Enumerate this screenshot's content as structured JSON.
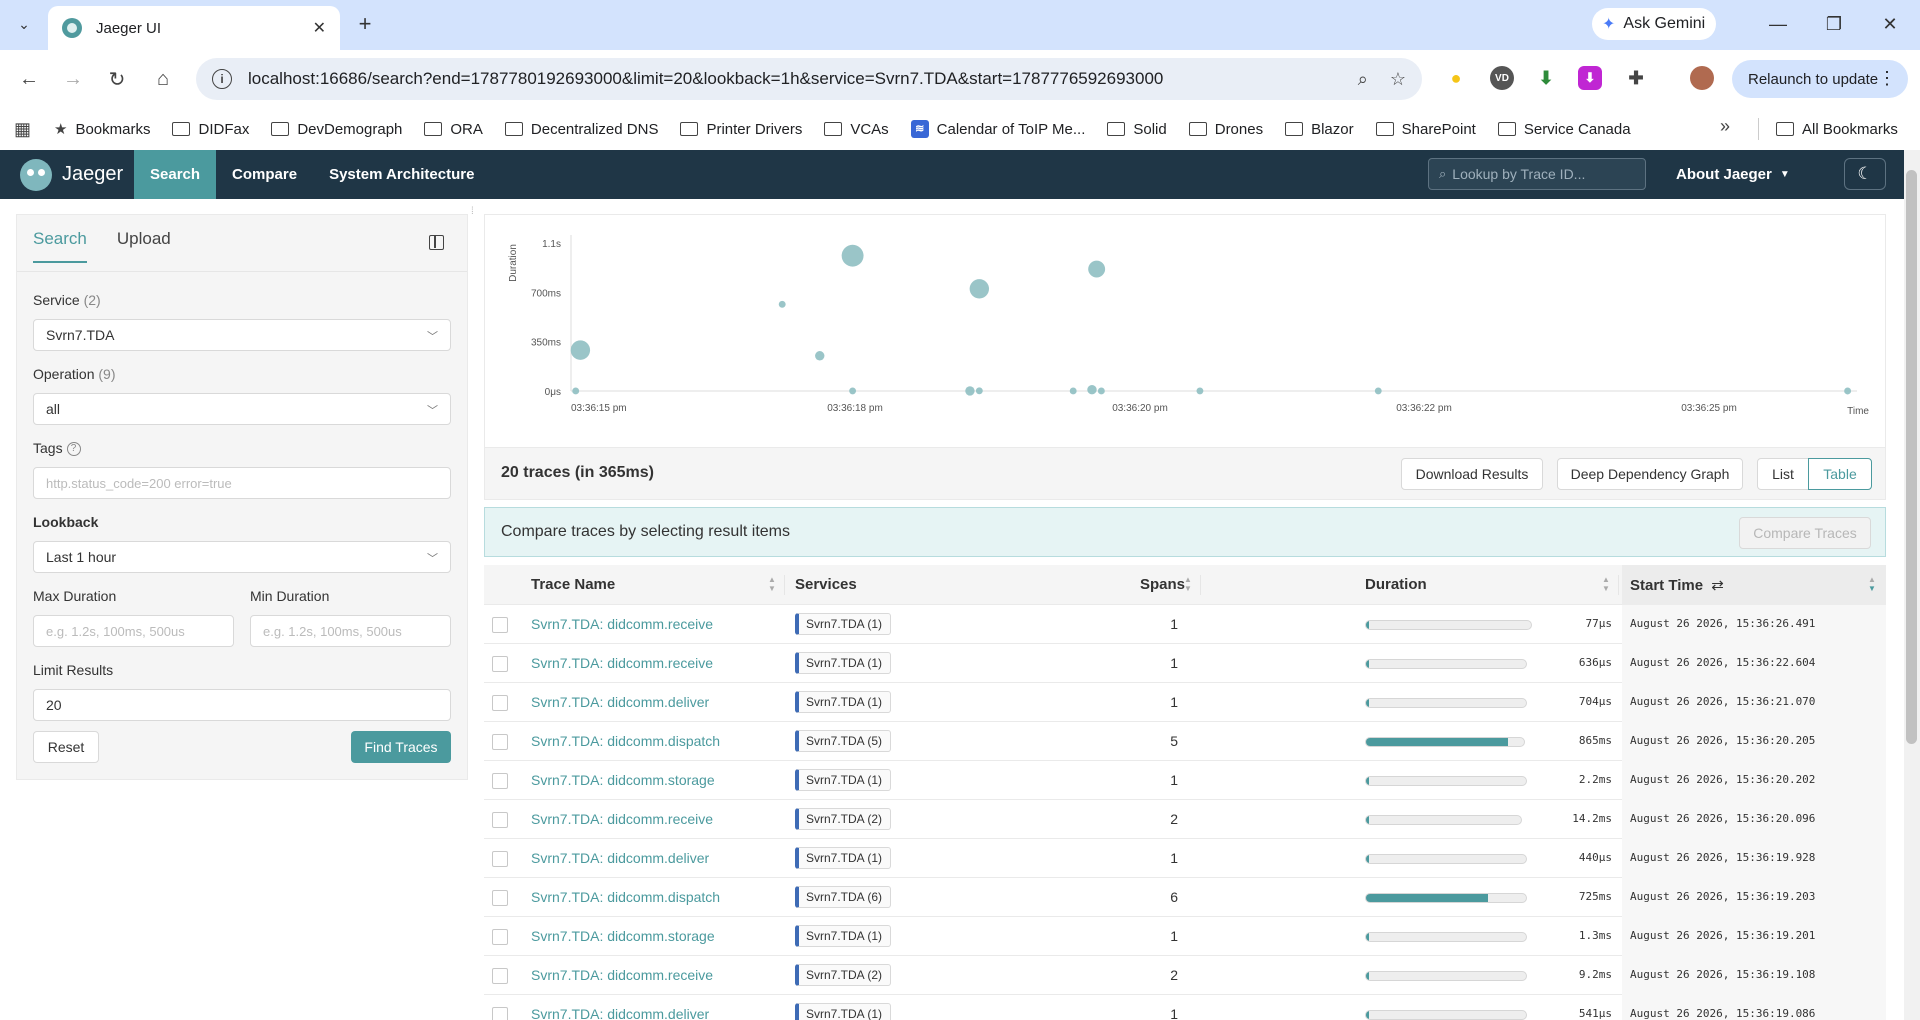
{
  "browser": {
    "tab_title": "Jaeger UI",
    "url": "localhost:16686/search?end=1787780192693000&limit=20&lookback=1h&service=Svrn7.TDA&start=1787776592693000",
    "gemini_label": "Ask Gemini",
    "relaunch_label": "Relaunch to update",
    "bookmarks": [
      "Bookmarks",
      "DIDFax",
      "DevDemograph",
      "ORA",
      "Decentralized DNS",
      "Printer Drivers",
      "VCAs",
      "Calendar of ToIP Me...",
      "Solid",
      "Drones",
      "Blazor",
      "SharePoint",
      "Service Canada"
    ],
    "all_bookmarks": "All Bookmarks"
  },
  "nav": {
    "brand": "Jaeger",
    "items": [
      "Search",
      "Compare",
      "System Architecture"
    ],
    "lookup_placeholder": "Lookup by Trace ID...",
    "about": "About Jaeger"
  },
  "form": {
    "tabs": [
      "Search",
      "Upload"
    ],
    "service_label": "Service",
    "service_count": "(2)",
    "service_value": "Svrn7.TDA",
    "operation_label": "Operation",
    "operation_count": "(9)",
    "operation_value": "all",
    "tags_label": "Tags",
    "tags_placeholder": "http.status_code=200 error=true",
    "lookback_label": "Lookback",
    "lookback_value": "Last 1 hour",
    "max_duration_label": "Max Duration",
    "max_duration_placeholder": "e.g. 1.2s, 100ms, 500us",
    "min_duration_label": "Min Duration",
    "min_duration_placeholder": "e.g. 1.2s, 100ms, 500us",
    "limit_label": "Limit Results",
    "limit_value": "20",
    "reset_label": "Reset",
    "find_label": "Find Traces"
  },
  "chart_data": {
    "type": "scatter",
    "xlabel": "Time",
    "ylabel": "Duration",
    "y_ticks": [
      "0μs",
      "350ms",
      "700ms",
      "1.1s"
    ],
    "x_ticks": [
      "03:36:15 pm",
      "03:36:18 pm",
      "03:36:20 pm",
      "03:36:22 pm",
      "03:36:25 pm"
    ],
    "ylim_ms": [
      0,
      1050
    ],
    "xlim_s": [
      0,
      13.7
    ],
    "color": "#8fbfc2",
    "points": [
      {
        "t": 0.05,
        "ms": 0.2,
        "spans": 1
      },
      {
        "t": 0.1,
        "ms": 290,
        "spans": 6
      },
      {
        "t": 2.25,
        "ms": 615,
        "spans": 1
      },
      {
        "t": 2.65,
        "ms": 250,
        "spans": 2
      },
      {
        "t": 3.0,
        "ms": 960,
        "spans": 7
      },
      {
        "t": 3.0,
        "ms": 0.5,
        "spans": 1
      },
      {
        "t": 4.25,
        "ms": 0.5,
        "spans": 2
      },
      {
        "t": 4.35,
        "ms": 725,
        "spans": 6
      },
      {
        "t": 4.35,
        "ms": 1.3,
        "spans": 1
      },
      {
        "t": 5.35,
        "ms": 0.4,
        "spans": 1
      },
      {
        "t": 5.55,
        "ms": 9.2,
        "spans": 2
      },
      {
        "t": 5.6,
        "ms": 865,
        "spans": 5
      },
      {
        "t": 5.65,
        "ms": 0.4,
        "spans": 1
      },
      {
        "t": 6.7,
        "ms": 0.7,
        "spans": 1
      },
      {
        "t": 8.6,
        "ms": 0.6,
        "spans": 1
      },
      {
        "t": 13.6,
        "ms": 0.08,
        "spans": 1
      }
    ]
  },
  "results": {
    "count_label": "20 traces (in 365ms)",
    "download_label": "Download Results",
    "ddg_label": "Deep Dependency Graph",
    "list_label": "List",
    "table_label": "Table",
    "compare_text": "Compare traces by selecting result items",
    "compare_btn": "Compare Traces",
    "columns": [
      "Trace Name",
      "Services",
      "Spans",
      "Duration",
      "Start Time"
    ],
    "rows": [
      {
        "name": "Svrn7.TDA: didcomm.receive",
        "service": "Svrn7.TDA (1)",
        "spans": "1",
        "fraction": 0.01,
        "duration": "77μs",
        "start": "August 26 2026, 15:36:26.491"
      },
      {
        "name": "Svrn7.TDA: didcomm.receive",
        "service": "Svrn7.TDA (1)",
        "spans": "1",
        "fraction": 0.01,
        "duration": "636μs",
        "start": "August 26 2026, 15:36:22.604"
      },
      {
        "name": "Svrn7.TDA: didcomm.deliver",
        "service": "Svrn7.TDA (1)",
        "spans": "1",
        "fraction": 0.01,
        "duration": "704μs",
        "start": "August 26 2026, 15:36:21.070"
      },
      {
        "name": "Svrn7.TDA: didcomm.dispatch",
        "service": "Svrn7.TDA (5)",
        "spans": "5",
        "fraction": 0.9,
        "duration": "865ms",
        "start": "August 26 2026, 15:36:20.205"
      },
      {
        "name": "Svrn7.TDA: didcomm.storage",
        "service": "Svrn7.TDA (1)",
        "spans": "1",
        "fraction": 0.01,
        "duration": "2.2ms",
        "start": "August 26 2026, 15:36:20.202"
      },
      {
        "name": "Svrn7.TDA: didcomm.receive",
        "service": "Svrn7.TDA (2)",
        "spans": "2",
        "fraction": 0.015,
        "duration": "14.2ms",
        "start": "August 26 2026, 15:36:20.096"
      },
      {
        "name": "Svrn7.TDA: didcomm.deliver",
        "service": "Svrn7.TDA (1)",
        "spans": "1",
        "fraction": 0.01,
        "duration": "440μs",
        "start": "August 26 2026, 15:36:19.928"
      },
      {
        "name": "Svrn7.TDA: didcomm.dispatch",
        "service": "Svrn7.TDA (6)",
        "spans": "6",
        "fraction": 0.76,
        "duration": "725ms",
        "start": "August 26 2026, 15:36:19.203"
      },
      {
        "name": "Svrn7.TDA: didcomm.storage",
        "service": "Svrn7.TDA (1)",
        "spans": "1",
        "fraction": 0.01,
        "duration": "1.3ms",
        "start": "August 26 2026, 15:36:19.201"
      },
      {
        "name": "Svrn7.TDA: didcomm.receive",
        "service": "Svrn7.TDA (2)",
        "spans": "2",
        "fraction": 0.012,
        "duration": "9.2ms",
        "start": "August 26 2026, 15:36:19.108"
      },
      {
        "name": "Svrn7.TDA: didcomm.deliver",
        "service": "Svrn7.TDA (1)",
        "spans": "1",
        "fraction": 0.01,
        "duration": "541μs",
        "start": "August 26 2026, 15:36:19.086"
      }
    ]
  }
}
